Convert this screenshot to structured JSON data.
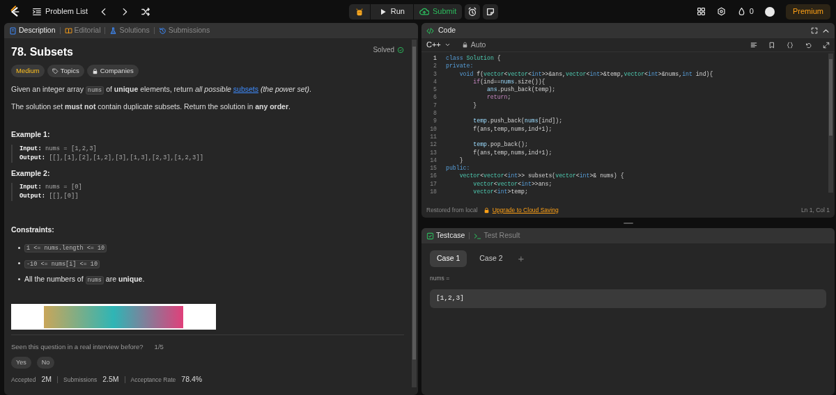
{
  "topbar": {
    "problem_list": "Problem List",
    "run": "Run",
    "submit": "Submit",
    "streak": "0",
    "premium": "Premium"
  },
  "left_tabs": [
    {
      "label": "Description",
      "selected": true,
      "kind": "doc"
    },
    {
      "label": "Editorial",
      "selected": false,
      "kind": "book"
    },
    {
      "label": "Solutions",
      "selected": false,
      "kind": "flask"
    },
    {
      "label": "Submissions",
      "selected": false,
      "kind": "history"
    }
  ],
  "problem": {
    "title": "78. Subsets",
    "status": "Solved",
    "tags": [
      {
        "label": "Medium",
        "kind": "difficulty"
      },
      {
        "label": "Topics",
        "kind": "tag"
      },
      {
        "label": "Companies",
        "kind": "lock"
      }
    ],
    "paragraphs": [
      [
        {
          "kind": "text",
          "text": "Given an integer array "
        },
        {
          "kind": "code",
          "text": "nums"
        },
        {
          "kind": "text",
          "text": " of **unique** elements, return *all possible* "
        },
        {
          "kind": "link",
          "text": "subsets"
        },
        {
          "kind": "text",
          "text": " *(the power set)*."
        }
      ],
      [
        {
          "kind": "text",
          "text": "The solution set **must not** contain duplicate subsets. Return the solution in **any order**."
        }
      ]
    ],
    "examples": [
      {
        "title": "Example 1:",
        "lines": [
          {
            "label": "Input:",
            "value": "nums = [1,2,3]"
          },
          {
            "label": "Output:",
            "value": "[[],[1],[2],[1,2],[3],[1,3],[2,3],[1,2,3]]"
          }
        ]
      },
      {
        "title": "Example 2:",
        "lines": [
          {
            "label": "Input:",
            "value": "nums = [0]"
          },
          {
            "label": "Output:",
            "value": "[[],[0]]"
          }
        ]
      }
    ],
    "constraints_title": "Constraints:",
    "constraints": [
      [
        {
          "kind": "code",
          "text": "1 <= nums.length <= 10"
        }
      ],
      [
        {
          "kind": "code",
          "text": "-10 <= nums[i] <= 10"
        }
      ],
      [
        {
          "kind": "text",
          "text": "All the numbers of "
        },
        {
          "kind": "code",
          "text": "nums"
        },
        {
          "kind": "text",
          "text": " are **unique**."
        }
      ]
    ],
    "feedback": {
      "question": "Seen this question in a real interview before?",
      "count": "1/5",
      "buttons": [
        "Yes",
        "No"
      ]
    },
    "stats": [
      {
        "label": "Accepted",
        "value": "2M"
      },
      {
        "label": "Submissions",
        "value": "2.5M"
      },
      {
        "label": "Acceptance Rate",
        "value": "78.4%"
      }
    ]
  },
  "code_panel": {
    "title": "Code",
    "language": "C++",
    "mode": "Auto",
    "lines": [
      {
        "n": "1",
        "current": true,
        "tokens": [
          {
            "text": "class",
            "kind": "kw"
          },
          {
            "text": " Solution",
            "kind": "ty"
          },
          {
            "text": " {",
            "kind": "p"
          }
        ]
      },
      {
        "n": "2",
        "current": false,
        "tokens": [
          {
            "text": "private:",
            "kind": "kw"
          }
        ]
      },
      {
        "n": "3",
        "current": false,
        "tokens": [
          {
            "text": "    void",
            "kind": "kw"
          },
          {
            "text": " f(",
            "kind": "p"
          },
          {
            "text": "vector",
            "kind": "ty"
          },
          {
            "text": "<",
            "kind": "p"
          },
          {
            "text": "vector",
            "kind": "ty"
          },
          {
            "text": "<",
            "kind": "p"
          },
          {
            "text": "int",
            "kind": "kw"
          },
          {
            "text": ">>&ans,",
            "kind": "p"
          },
          {
            "text": "vector",
            "kind": "ty"
          },
          {
            "text": "<",
            "kind": "p"
          },
          {
            "text": "int",
            "kind": "kw"
          },
          {
            "text": ">&temp,",
            "kind": "p"
          },
          {
            "text": "vector",
            "kind": "ty"
          },
          {
            "text": "<",
            "kind": "p"
          },
          {
            "text": "int",
            "kind": "kw"
          },
          {
            "text": ">&nums,",
            "kind": "p"
          },
          {
            "text": "int",
            "kind": "kw"
          },
          {
            "text": " ind){",
            "kind": "p"
          }
        ]
      },
      {
        "n": "4",
        "current": false,
        "tokens": [
          {
            "text": "        if",
            "kind": "ct"
          },
          {
            "text": "(ind==",
            "kind": "p"
          },
          {
            "text": "nums",
            "kind": "va"
          },
          {
            "text": ".size()){",
            "kind": "p"
          }
        ]
      },
      {
        "n": "5",
        "current": false,
        "tokens": [
          {
            "text": "            ans",
            "kind": "va"
          },
          {
            "text": ".push_back(temp);",
            "kind": "p"
          }
        ]
      },
      {
        "n": "6",
        "current": false,
        "tokens": [
          {
            "text": "            return",
            "kind": "ct"
          },
          {
            "text": ";",
            "kind": "p"
          }
        ]
      },
      {
        "n": "7",
        "current": false,
        "tokens": [
          {
            "text": "        }",
            "kind": "p"
          }
        ]
      },
      {
        "n": "8",
        "current": false
      },
      {
        "n": "9",
        "current": false,
        "tokens": [
          {
            "text": "        temp",
            "kind": "va"
          },
          {
            "text": ".push_back(",
            "kind": "p"
          },
          {
            "text": "nums",
            "kind": "va"
          },
          {
            "text": "[ind]);",
            "kind": "p"
          }
        ]
      },
      {
        "n": "10",
        "current": false,
        "tokens": [
          {
            "text": "        f(ans,temp,nums,ind+1);",
            "kind": "p"
          }
        ]
      },
      {
        "n": "11",
        "current": false
      },
      {
        "n": "12",
        "current": false,
        "tokens": [
          {
            "text": "        temp",
            "kind": "va"
          },
          {
            "text": ".pop_back();",
            "kind": "p"
          }
        ]
      },
      {
        "n": "13",
        "current": false,
        "tokens": [
          {
            "text": "        f(ans,temp,nums,ind+1);",
            "kind": "p"
          }
        ]
      },
      {
        "n": "14",
        "current": false,
        "tokens": [
          {
            "text": "    }",
            "kind": "p"
          }
        ]
      },
      {
        "n": "15",
        "current": false,
        "tokens": [
          {
            "text": "public:",
            "kind": "kw"
          }
        ]
      },
      {
        "n": "16",
        "current": false,
        "tokens": [
          {
            "text": "    vector",
            "kind": "ty"
          },
          {
            "text": "<",
            "kind": "p"
          },
          {
            "text": "vector",
            "kind": "ty"
          },
          {
            "text": "<",
            "kind": "p"
          },
          {
            "text": "int",
            "kind": "kw"
          },
          {
            "text": ">> subsets(",
            "kind": "p"
          },
          {
            "text": "vector",
            "kind": "ty"
          },
          {
            "text": "<",
            "kind": "p"
          },
          {
            "text": "int",
            "kind": "kw"
          },
          {
            "text": ">& nums) {",
            "kind": "p"
          }
        ]
      },
      {
        "n": "17",
        "current": false,
        "tokens": [
          {
            "text": "        vector",
            "kind": "ty"
          },
          {
            "text": "<",
            "kind": "p"
          },
          {
            "text": "vector",
            "kind": "ty"
          },
          {
            "text": "<",
            "kind": "p"
          },
          {
            "text": "int",
            "kind": "kw"
          },
          {
            "text": ">>ans;",
            "kind": "p"
          }
        ]
      },
      {
        "n": "18",
        "current": false,
        "tokens": [
          {
            "text": "        vector",
            "kind": "ty"
          },
          {
            "text": "<",
            "kind": "p"
          },
          {
            "text": "int",
            "kind": "kw"
          },
          {
            "text": ">temp;",
            "kind": "p"
          }
        ]
      }
    ],
    "restored": "Restored from local",
    "upgrade": "Upgrade to Cloud Saving",
    "cursor": "Ln 1, Col 1"
  },
  "test_panel": {
    "tabs": [
      {
        "label": "Testcase",
        "selected": true,
        "kind": "check"
      },
      {
        "label": "Test Result",
        "selected": false,
        "kind": "terminal"
      }
    ],
    "cases": [
      {
        "label": "Case 1",
        "selected": true
      },
      {
        "label": "Case 2",
        "selected": false
      }
    ],
    "add": "+",
    "param": "nums =",
    "value": "[1,2,3]"
  }
}
